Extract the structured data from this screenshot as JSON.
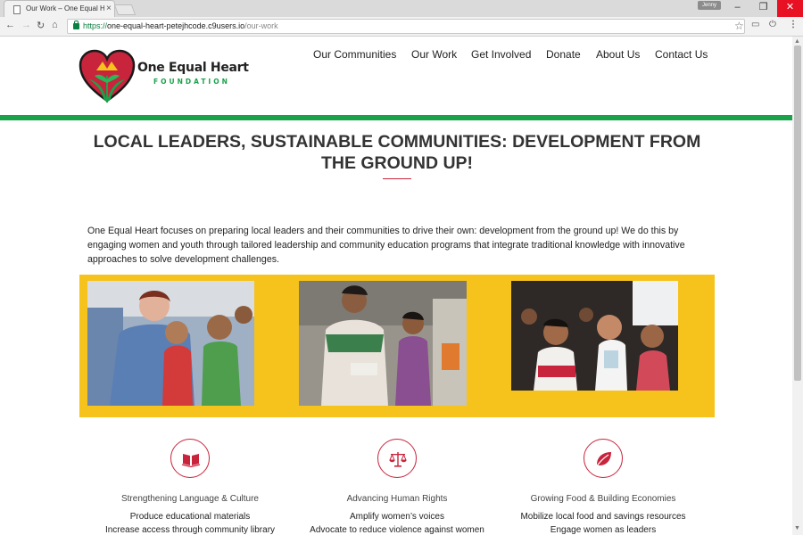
{
  "browser": {
    "tab_title": "Our Work – One Equal H",
    "tab_close": "×",
    "profile_label": "Jenny",
    "url_scheme": "https://",
    "url_host": "one-equal-heart-petejhcode.c9users.io",
    "url_path": "/our-work",
    "window_controls": {
      "minimize": "–",
      "maximize": "❐",
      "close": "✕"
    },
    "nav_icons": {
      "back": "←",
      "forward": "→",
      "reload": "↻",
      "home": "⌂",
      "bookmark": "☆",
      "cast": "▭",
      "power": "⏻",
      "menu": "⋮"
    }
  },
  "site": {
    "logo": {
      "name": "One Equal Heart",
      "subtitle": "FOUNDATION"
    },
    "nav": [
      "Our Communities",
      "Our Work",
      "Get Involved",
      "Donate",
      "About Us",
      "Contact Us"
    ],
    "brand_colors": {
      "green": "#19a24a",
      "red": "#c8243c",
      "yellow": "#f6c21c"
    }
  },
  "hero": {
    "title": "LOCAL LEADERS, SUSTAINABLE COMMUNITIES: DEVELOPMENT FROM THE GROUND UP!",
    "intro": "One Equal Heart focuses on preparing local leaders and their communities to drive their own: development from the ground up! We do this by engaging women and youth through tailored leadership and community education programs that integrate traditional knowledge with innovative approaches to solve development challenges."
  },
  "focus_areas": [
    {
      "icon": "book-icon",
      "title": "Strengthening Language & Culture",
      "items": [
        "Produce educational materials",
        "Increase access through community library"
      ]
    },
    {
      "icon": "scales-icon",
      "title": "Advancing Human Rights",
      "items": [
        "Amplify women’s voices",
        "Advocate to reduce violence against women"
      ]
    },
    {
      "icon": "leaf-icon",
      "title": "Growing Food & Building Economies",
      "items": [
        "Mobilize local food and savings resources",
        "Engage women as leaders"
      ]
    }
  ]
}
